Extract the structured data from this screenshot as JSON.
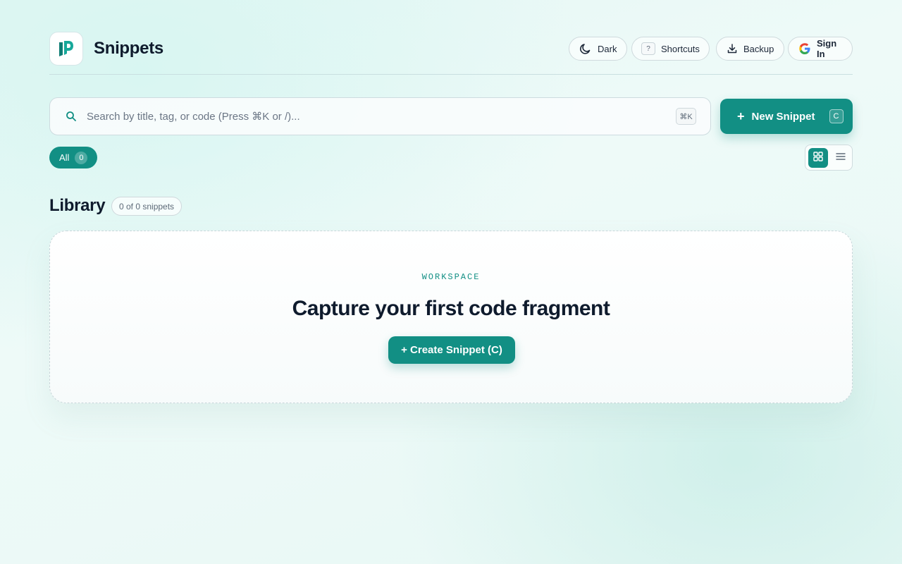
{
  "app": {
    "title": "Snippets",
    "logo_icon": "snippets-logo-icon"
  },
  "header": {
    "dark_label": "Dark",
    "shortcuts_key": "?",
    "shortcuts_label": "Shortcuts",
    "backup_label": "Backup",
    "signin_label": "Sign In"
  },
  "search": {
    "placeholder": "Search by title, tag, or code (Press ⌘K or /)...",
    "value": "",
    "shortcut": "⌘K"
  },
  "new_snippet": {
    "plus": "+",
    "label": "New Snippet",
    "shortcut": "C"
  },
  "filters": {
    "all_label": "All",
    "all_count": "0"
  },
  "view": {
    "active": "grid"
  },
  "library": {
    "title": "Library",
    "count_label": "0 of 0 snippets"
  },
  "empty_state": {
    "eyebrow": "WORKSPACE",
    "title": "Capture your first code fragment",
    "cta_label": "+ Create Snippet (C)"
  },
  "colors": {
    "accent": "#128f84",
    "text": "#0f1b2d"
  }
}
